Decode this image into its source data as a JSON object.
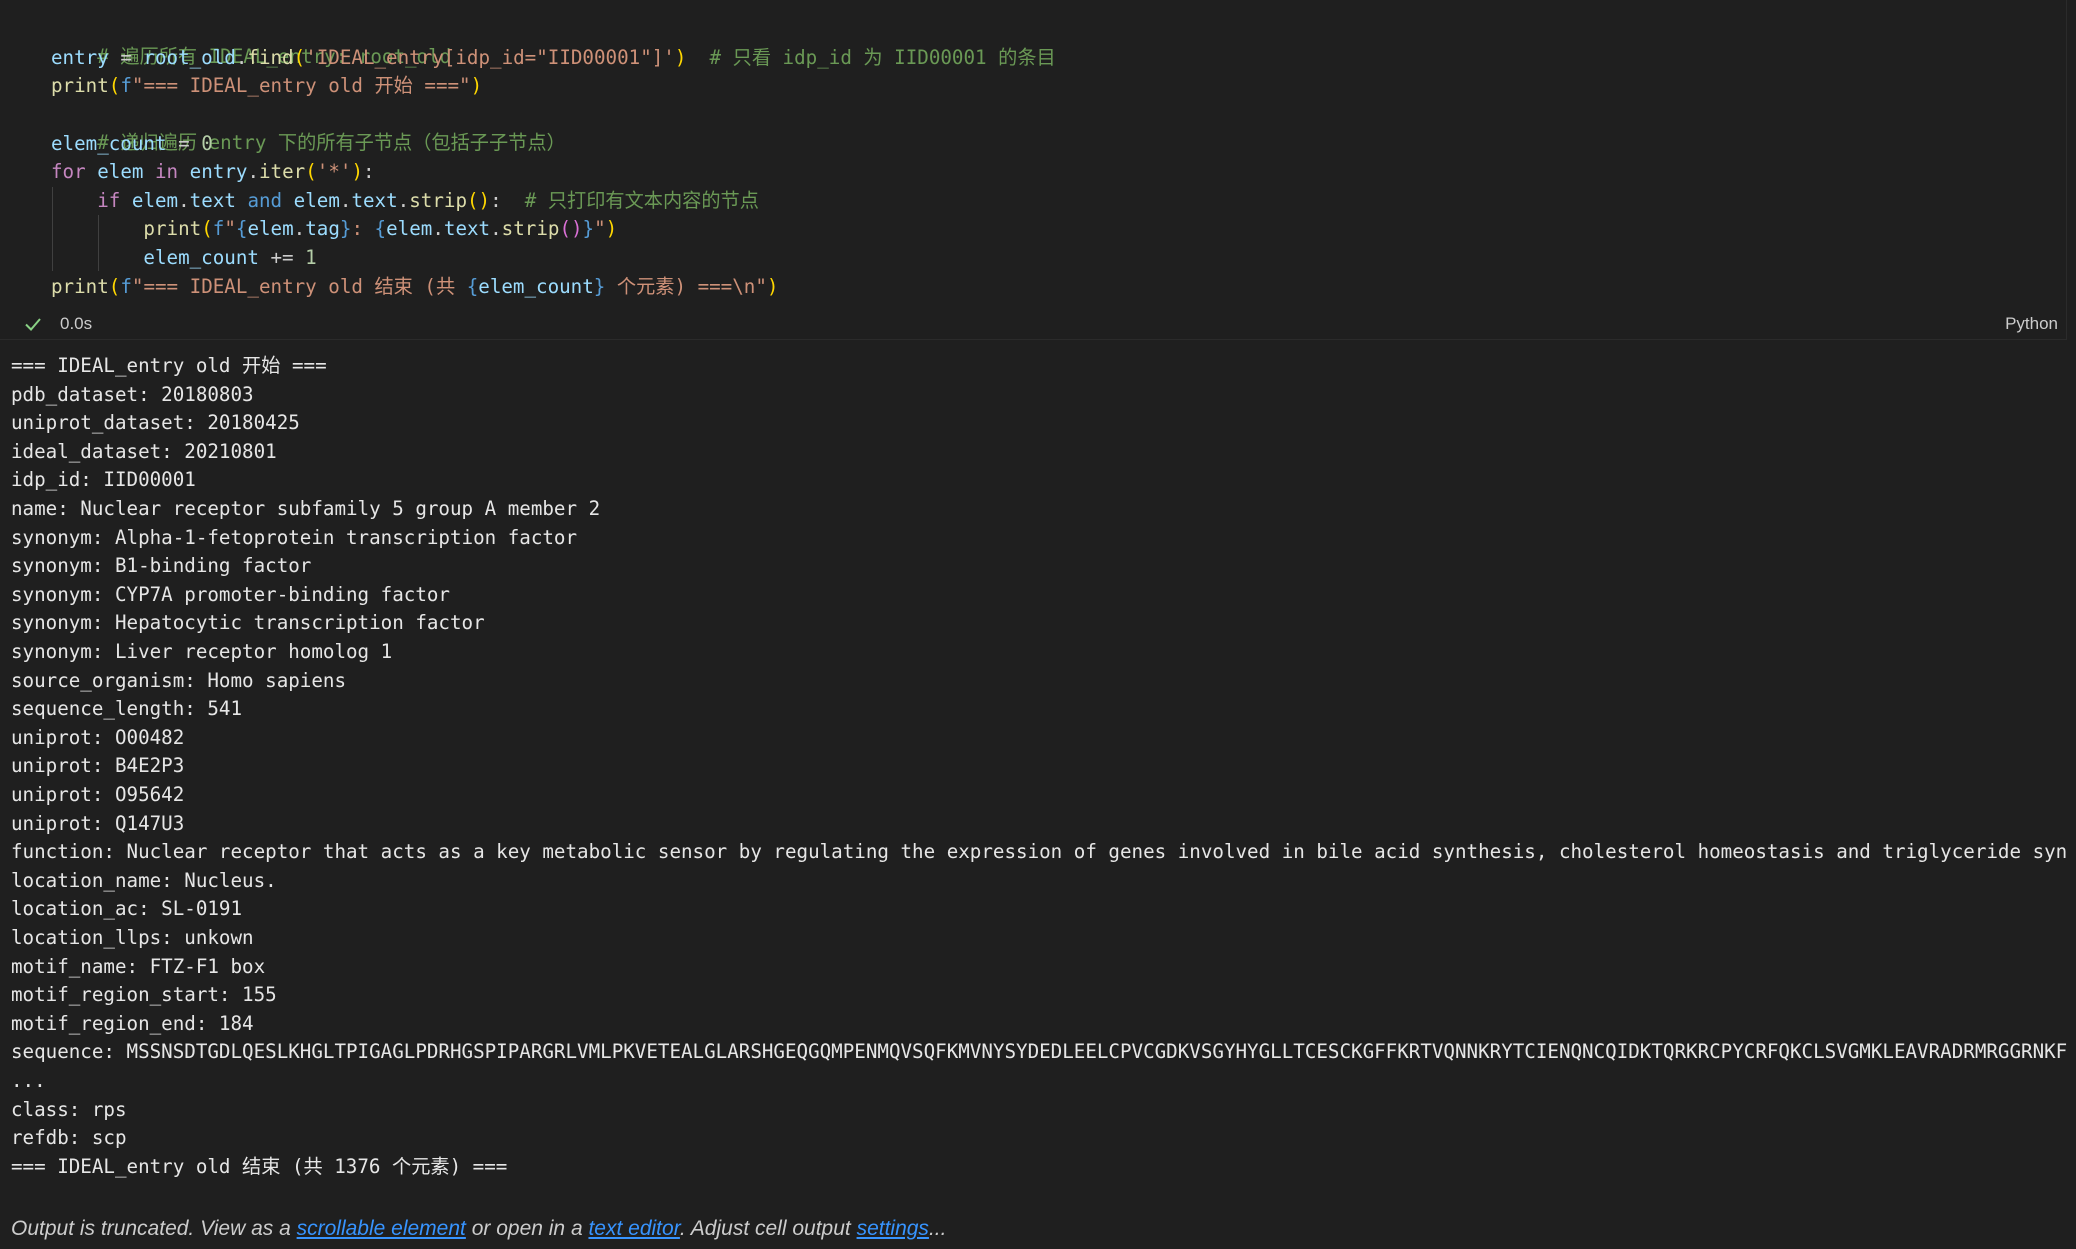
{
  "code_lines": [
    "# 遍历所有 IDEAL_entry: root_old",
    "entry = root_old.find('IDEAL_entry[idp_id=\"IID00001\"]')  # 只看 idp_id 为 IID00001 的条目",
    "print(f\"=== IDEAL_entry old 开始 ===\")",
    "# 递归遍历 entry 下的所有子节点（包括子子节点）",
    "elem_count = 0",
    "for elem in entry.iter('*'):",
    "    if elem.text and elem.text.strip():  # 只打印有文本内容的节点",
    "        print(f\"{elem.tag}: {elem.text.strip()}\")",
    "        elem_count += 1",
    "print(f\"=== IDEAL_entry old 结束 (共 {elem_count} 个元素) ===\\n\")"
  ],
  "cell_status": {
    "exec_time": "0.0s",
    "language": "Python",
    "status_color": "#89d185"
  },
  "output_lines": [
    "=== IDEAL_entry old 开始 ===",
    "pdb_dataset: 20180803",
    "uniprot_dataset: 20180425",
    "ideal_dataset: 20210801",
    "idp_id: IID00001",
    "name: Nuclear receptor subfamily 5 group A member 2",
    "synonym: Alpha-1-fetoprotein transcription factor",
    "synonym: B1-binding factor",
    "synonym: CYP7A promoter-binding factor",
    "synonym: Hepatocytic transcription factor",
    "synonym: Liver receptor homolog 1",
    "source_organism: Homo sapiens",
    "sequence_length: 541",
    "uniprot: O00482",
    "uniprot: B4E2P3",
    "uniprot: O95642",
    "uniprot: Q147U3",
    "function: Nuclear receptor that acts as a key metabolic sensor by regulating the expression of genes involved in bile acid synthesis, cholesterol homeostasis and triglyceride syn",
    "location_name: Nucleus.",
    "location_ac: SL-0191",
    "location_llps: unkown",
    "motif_name: FTZ-F1 box",
    "motif_region_start: 155",
    "motif_region_end: 184",
    "sequence: MSSNSDTGDLQESLKHGLTPIGAGLPDRHGSPIPARGRLVMLPKVETEALGLARSHGEQGQMPENMQVSQFKMVNYSYDEDLEELCPVCGDKVSGYHYGLLTCESCKGFFKRTVQNNKRYTCIENQNCQIDKTQRKRCPYCRFQKCLSVGMKLEAVRADRMRGGRNKF",
    "...",
    "class: rps",
    "refdb: scp",
    "=== IDEAL_entry old 结束 (共 1376 个元素) ==="
  ],
  "truncation": {
    "prefix": "Output is truncated. View as a ",
    "link1": "scrollable element",
    "middle": " or open in a ",
    "link2": "text editor",
    "suffix": ". Adjust cell output ",
    "link3": "settings",
    "end": "..."
  }
}
